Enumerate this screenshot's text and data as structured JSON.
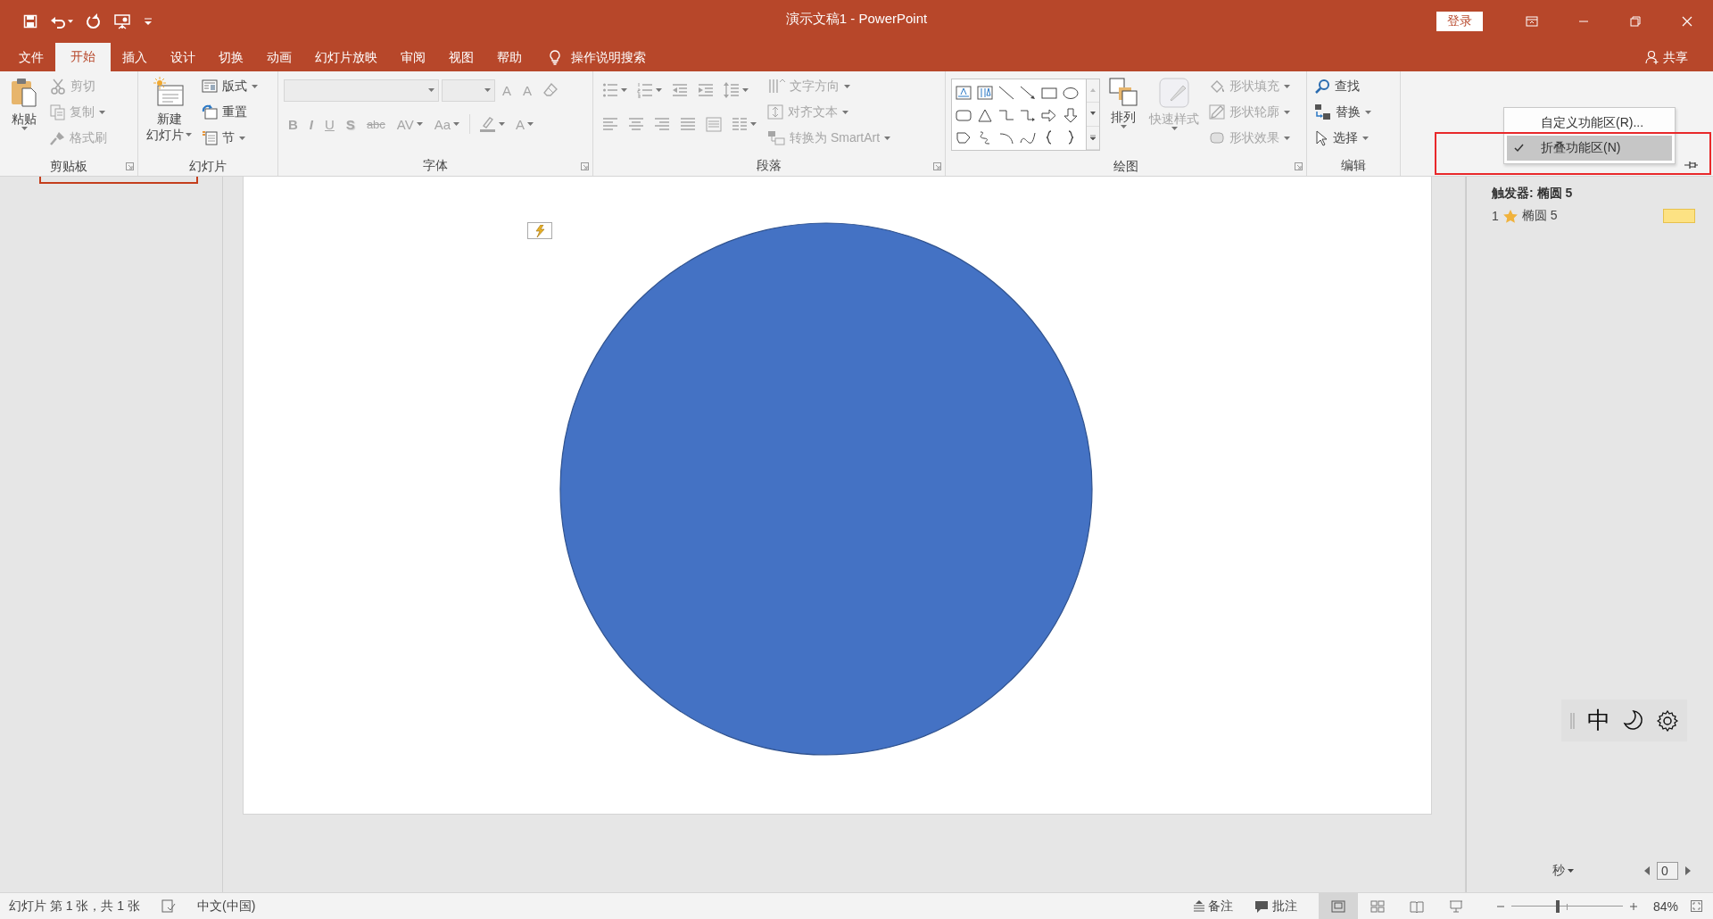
{
  "window": {
    "title": "演示文稿1 - PowerPoint",
    "login_button": "登录"
  },
  "tabs": [
    {
      "label": "文件",
      "selected": false
    },
    {
      "label": "开始",
      "selected": true
    },
    {
      "label": "插入",
      "selected": false
    },
    {
      "label": "设计",
      "selected": false
    },
    {
      "label": "切换",
      "selected": false
    },
    {
      "label": "动画",
      "selected": false
    },
    {
      "label": "幻灯片放映",
      "selected": false
    },
    {
      "label": "审阅",
      "selected": false
    },
    {
      "label": "视图",
      "selected": false
    },
    {
      "label": "帮助",
      "selected": false
    }
  ],
  "tell_me": "操作说明搜索",
  "share": "共享",
  "ribbon": {
    "groups": [
      {
        "label": "剪贴板",
        "launcher": true,
        "columns": [
          [
            {
              "kind": "large",
              "label": "粘贴",
              "disabled": false,
              "dropdown": true
            }
          ],
          [
            {
              "kind": "small",
              "label": "剪切",
              "disabled": true,
              "dropdown": false
            },
            {
              "kind": "small",
              "label": "复制",
              "disabled": true,
              "dropdown": true
            },
            {
              "kind": "small",
              "label": "格式刷",
              "disabled": true,
              "dropdown": false
            }
          ]
        ]
      },
      {
        "label": "幻灯片",
        "launcher": false,
        "columns": [
          [
            {
              "kind": "large",
              "label": "新建",
              "label_2": "幻灯片",
              "disabled": false,
              "dropdown": true
            }
          ],
          [
            {
              "kind": "small",
              "label": "版式",
              "disabled": false,
              "dropdown": true
            },
            {
              "kind": "small",
              "label": "重置",
              "disabled": false,
              "dropdown": false
            },
            {
              "kind": "small",
              "label": "节",
              "disabled": false,
              "dropdown": true
            }
          ]
        ]
      },
      {
        "label": "字体",
        "launcher": true,
        "columns": [
          [
            {
              "kind": "row",
              "items": [
                {
                  "kind": "fontbox",
                  "disabled": true
                },
                {
                  "kind": "sizebox",
                  "disabled": true
                },
                {
                  "kind": "glyph",
                  "label": "A",
                  "disabled": true,
                  "dropdown": false
                },
                {
                  "kind": "glyph",
                  "label": "A",
                  "disabled": true,
                  "dropdown": false
                },
                {
                  "kind": "icon",
                  "disabled": true,
                  "dropdown": false
                }
              ]
            },
            {
              "kind": "row",
              "items": [
                {
                  "kind": "glyph",
                  "label": "B",
                  "disabled": true,
                  "dropdown": false
                },
                {
                  "kind": "glyph",
                  "label": "I",
                  "disabled": true,
                  "dropdown": false
                },
                {
                  "kind": "glyph",
                  "label": "U",
                  "disabled": true,
                  "dropdown": false
                },
                {
                  "kind": "glyph",
                  "label": "S",
                  "disabled": true,
                  "dropdown": false
                },
                {
                  "kind": "glyph",
                  "label": "abc",
                  "disabled": true,
                  "dropdown": false
                },
                {
                  "kind": "glyph",
                  "label": "AV",
                  "disabled": true,
                  "dropdown": true
                },
                {
                  "kind": "glyph",
                  "label": "Aa",
                  "disabled": true,
                  "dropdown": true
                },
                {
                  "kind": "icon",
                  "disabled": true,
                  "dropdown": true
                },
                {
                  "kind": "glyph",
                  "label": "A",
                  "disabled": true,
                  "dropdown": true
                }
              ]
            }
          ]
        ]
      },
      {
        "label": "段落",
        "launcher": true,
        "columns": [
          [
            {
              "kind": "row",
              "items": [
                {
                  "kind": "icon",
                  "disabled": true,
                  "dropdown": true
                },
                {
                  "kind": "icon",
                  "disabled": true,
                  "dropdown": true
                },
                {
                  "kind": "icon",
                  "disabled": true,
                  "dropdown": false
                },
                {
                  "kind": "icon",
                  "disabled": true,
                  "dropdown": false
                },
                {
                  "kind": "icon",
                  "disabled": true,
                  "dropdown": true
                }
              ]
            },
            {
              "kind": "row",
              "items": [
                {
                  "kind": "icon",
                  "disabled": true,
                  "dropdown": false
                },
                {
                  "kind": "icon",
                  "disabled": true,
                  "dropdown": false
                },
                {
                  "kind": "icon",
                  "disabled": true,
                  "dropdown": false
                },
                {
                  "kind": "icon",
                  "disabled": true,
                  "dropdown": false
                },
                {
                  "kind": "icon",
                  "disabled": true,
                  "dropdown": false
                },
                {
                  "kind": "icon",
                  "disabled": true,
                  "dropdown": true
                }
              ]
            }
          ],
          [
            {
              "kind": "small",
              "label": "文字方向",
              "disabled": true,
              "dropdown": true
            },
            {
              "kind": "small",
              "label": "对齐文本",
              "disabled": true,
              "dropdown": true
            },
            {
              "kind": "small",
              "label": "转换为 SmartArt",
              "disabled": true,
              "dropdown": true
            }
          ]
        ]
      },
      {
        "label": "绘图",
        "launcher": true,
        "columns": [
          [
            {
              "kind": "gallery"
            }
          ],
          [
            {
              "kind": "large",
              "label": "排列",
              "disabled": false,
              "dropdown": true
            }
          ],
          [
            {
              "kind": "large",
              "label": "快速样式",
              "disabled": true,
              "dropdown": true
            }
          ],
          [
            {
              "kind": "small",
              "label": "形状填充",
              "disabled": true,
              "dropdown": true
            },
            {
              "kind": "small",
              "label": "形状轮廓",
              "disabled": true,
              "dropdown": true
            },
            {
              "kind": "small",
              "label": "形状效果",
              "disabled": true,
              "dropdown": true
            }
          ]
        ]
      },
      {
        "label": "编辑",
        "launcher": false,
        "columns": [
          [
            {
              "kind": "small",
              "label": "查找",
              "disabled": false,
              "dropdown": false
            },
            {
              "kind": "small",
              "label": "替换",
              "disabled": false,
              "dropdown": true
            },
            {
              "kind": "small",
              "label": "选择",
              "disabled": false,
              "dropdown": true
            }
          ]
        ]
      }
    ]
  },
  "ribbon_menu": {
    "items": [
      {
        "label": "自定义功能区(R)...",
        "checked": false,
        "selected": false
      },
      {
        "label": "折叠功能区(N)",
        "checked": true,
        "selected": true
      }
    ]
  },
  "animation_pane": {
    "trigger": "触发器: 椭圆 5",
    "items": [
      {
        "number": "1",
        "name": "椭圆 5"
      }
    ],
    "seconds_label": "秒",
    "spin_value": "0"
  },
  "ime_toolbar": {
    "mode": "中"
  },
  "status_bar": {
    "slide_info": "幻灯片 第 1 张，共 1 张",
    "language": "中文(中国)",
    "notes": "备注",
    "comments": "批注",
    "views": [
      {
        "selected": true
      },
      {
        "selected": false
      },
      {
        "selected": false
      },
      {
        "selected": false
      }
    ],
    "zoom": {
      "level": 0.42,
      "reading": "84%"
    }
  }
}
